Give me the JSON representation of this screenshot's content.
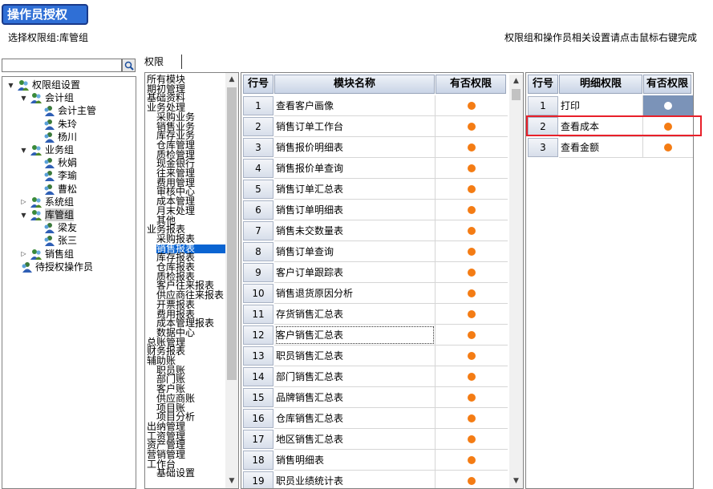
{
  "window": {
    "title": "操作员授权"
  },
  "header": {
    "group_caption": "选择权限组:库管组",
    "hint": "权限组和操作员相关设置请点击鼠标右键完成"
  },
  "search": {
    "value": "",
    "placeholder": ""
  },
  "tree": {
    "root": "权限组设置",
    "groups": [
      {
        "label": "会计组",
        "expanded": true,
        "members": [
          "会计主管",
          "朱玲",
          "杨川"
        ]
      },
      {
        "label": "业务组",
        "expanded": true,
        "members": [
          "秋娟",
          "李瑜",
          "曹松"
        ]
      },
      {
        "label": "系统组",
        "expanded": false,
        "members": []
      },
      {
        "label": "库管组",
        "expanded": true,
        "selected": true,
        "members": [
          "梁友",
          "张三"
        ]
      },
      {
        "label": "销售组",
        "expanded": false,
        "members": []
      }
    ],
    "pending": "待授权操作员"
  },
  "tabs": {
    "permission": "权限"
  },
  "modules": [
    {
      "label": "所有模块",
      "indent": 0
    },
    {
      "label": "期初管理",
      "indent": 0
    },
    {
      "label": "基础资料",
      "indent": 0
    },
    {
      "label": "业务处理",
      "indent": 0
    },
    {
      "label": "采购业务",
      "indent": 1
    },
    {
      "label": "销售业务",
      "indent": 1
    },
    {
      "label": "库存业务",
      "indent": 1
    },
    {
      "label": "仓库管理",
      "indent": 1
    },
    {
      "label": "质检管理",
      "indent": 1
    },
    {
      "label": "现金银行",
      "indent": 1
    },
    {
      "label": "往来管理",
      "indent": 1
    },
    {
      "label": "费用管理",
      "indent": 1
    },
    {
      "label": "审核中心",
      "indent": 1
    },
    {
      "label": "成本管理",
      "indent": 1
    },
    {
      "label": "月末处理",
      "indent": 1
    },
    {
      "label": "其他",
      "indent": 1
    },
    {
      "label": "业务报表",
      "indent": 0
    },
    {
      "label": "采购报表",
      "indent": 1
    },
    {
      "label": "销售报表",
      "indent": 1,
      "selected": true
    },
    {
      "label": "库存报表",
      "indent": 1
    },
    {
      "label": "仓库报表",
      "indent": 1
    },
    {
      "label": "质检报表",
      "indent": 1
    },
    {
      "label": "客户往来报表",
      "indent": 1
    },
    {
      "label": "供应商往来报表",
      "indent": 1
    },
    {
      "label": "开票报表",
      "indent": 1
    },
    {
      "label": "费用报表",
      "indent": 1
    },
    {
      "label": "成本管理报表",
      "indent": 1
    },
    {
      "label": "数据中心",
      "indent": 1
    },
    {
      "label": "总账管理",
      "indent": 0
    },
    {
      "label": "财务报表",
      "indent": 0
    },
    {
      "label": "辅助账",
      "indent": 0
    },
    {
      "label": "职员账",
      "indent": 1
    },
    {
      "label": "部门账",
      "indent": 1
    },
    {
      "label": "客户账",
      "indent": 1
    },
    {
      "label": "供应商账",
      "indent": 1
    },
    {
      "label": "项目账",
      "indent": 1
    },
    {
      "label": "项目分析",
      "indent": 1
    },
    {
      "label": "出纳管理",
      "indent": 0
    },
    {
      "label": "工资管理",
      "indent": 0
    },
    {
      "label": "资产管理",
      "indent": 0
    },
    {
      "label": "营销管理",
      "indent": 0
    },
    {
      "label": "工作台",
      "indent": 0
    },
    {
      "label": "基础设置",
      "indent": 1
    }
  ],
  "main_grid": {
    "headers": {
      "row": "行号",
      "name": "模块名称",
      "perm": "有否权限"
    },
    "rows": [
      {
        "no": "1",
        "name": "查看客户画像"
      },
      {
        "no": "2",
        "name": "销售订单工作台"
      },
      {
        "no": "3",
        "name": "销售报价明细表"
      },
      {
        "no": "4",
        "name": "销售报价单查询"
      },
      {
        "no": "5",
        "name": "销售订单汇总表"
      },
      {
        "no": "6",
        "name": "销售订单明细表"
      },
      {
        "no": "7",
        "name": "销售未交数量表"
      },
      {
        "no": "8",
        "name": "销售订单查询"
      },
      {
        "no": "9",
        "name": "客户订单跟踪表"
      },
      {
        "no": "10",
        "name": "销售退货原因分析"
      },
      {
        "no": "11",
        "name": "存货销售汇总表"
      },
      {
        "no": "12",
        "name": "客户销售汇总表"
      },
      {
        "no": "13",
        "name": "职员销售汇总表"
      },
      {
        "no": "14",
        "name": "部门销售汇总表"
      },
      {
        "no": "15",
        "name": "品牌销售汇总表"
      },
      {
        "no": "16",
        "name": "仓库销售汇总表"
      },
      {
        "no": "17",
        "name": "地区销售汇总表"
      },
      {
        "no": "18",
        "name": "销售明细表"
      },
      {
        "no": "19",
        "name": "职员业绩统计表"
      }
    ]
  },
  "detail_grid": {
    "headers": {
      "row": "行号",
      "name": "明细权限",
      "perm": "有否权限"
    },
    "rows": [
      {
        "no": "1",
        "name": "打印",
        "granted": false
      },
      {
        "no": "2",
        "name": "查看成本",
        "granted": true
      },
      {
        "no": "3",
        "name": "查看金额",
        "granted": true
      }
    ]
  },
  "colors": {
    "granted_dot": "#f47c14",
    "selection": "#0a64d2",
    "highlight": "#e8202a"
  }
}
